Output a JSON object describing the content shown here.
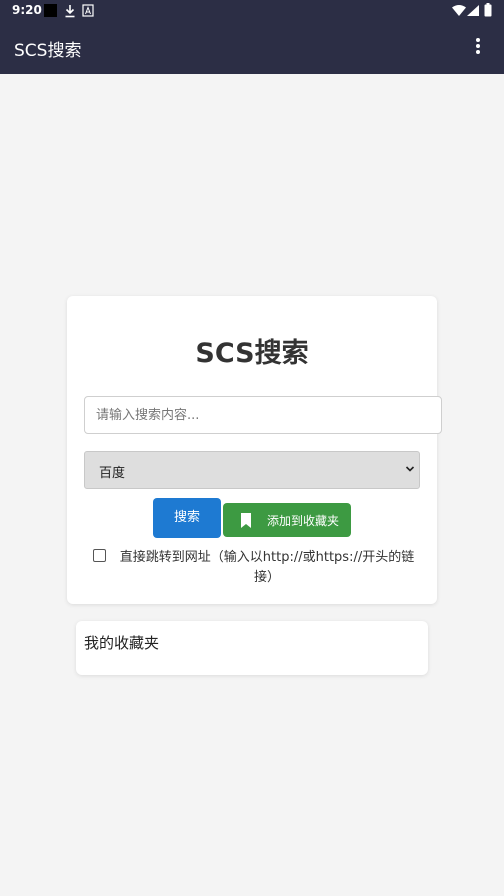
{
  "status_bar": {
    "time": "9:20"
  },
  "app_bar": {
    "title": "SCS搜索"
  },
  "search_card": {
    "title": "SCS搜索",
    "input_placeholder": "请输入搜索内容...",
    "input_value": "",
    "engine_selected": "百度",
    "search_button": "搜索",
    "favorite_button": "添加到收藏夹",
    "direct_jump_label": "直接跳转到网址（输入以http://或https://开头的链接）",
    "direct_jump_checked": false
  },
  "favorites": {
    "title": "我的收藏夹"
  }
}
